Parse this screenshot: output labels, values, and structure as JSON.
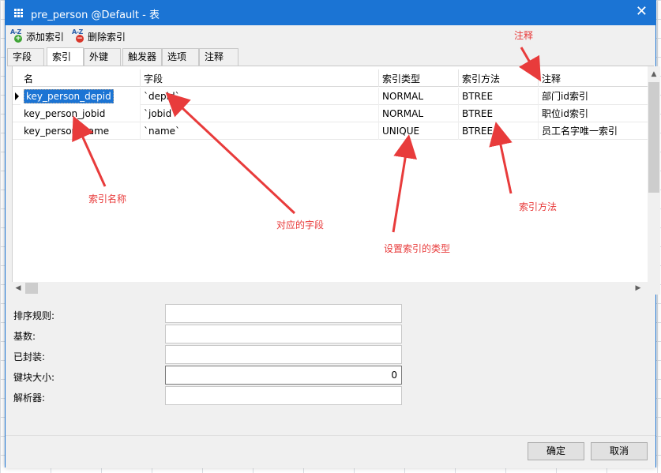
{
  "window": {
    "title": "pre_person @Default - 表",
    "close_label": "✕"
  },
  "toolbar": {
    "add_index": "添加索引",
    "delete_index": "删除索引",
    "add_glyph": "+",
    "delete_glyph": "−",
    "az_glyph": "A-Z"
  },
  "tabs": [
    {
      "label": "字段",
      "active": false
    },
    {
      "label": "索引",
      "active": true
    },
    {
      "label": "外键",
      "active": false
    },
    {
      "label": "触发器",
      "active": false
    },
    {
      "label": "选项",
      "active": false
    },
    {
      "label": "注释",
      "active": false
    }
  ],
  "grid": {
    "headers": [
      "名",
      "字段",
      "索引类型",
      "索引方法",
      "注释"
    ],
    "rows": [
      {
        "name": "key_person_depid",
        "field": "`depid`",
        "type": "NORMAL",
        "method": "BTREE",
        "comment": "部门id索引",
        "selected": true
      },
      {
        "name": "key_person_jobid",
        "field": "`jobid`",
        "type": "NORMAL",
        "method": "BTREE",
        "comment": "职位id索引",
        "selected": false
      },
      {
        "name": "key_person_name",
        "field": "`name`",
        "type": "UNIQUE",
        "method": "BTREE",
        "comment": "员工名字唯一索引",
        "selected": false
      }
    ]
  },
  "properties": [
    {
      "label": "排序规则:",
      "value": ""
    },
    {
      "label": "基数:",
      "value": ""
    },
    {
      "label": "已封装:",
      "value": ""
    },
    {
      "label": "键块大小:",
      "value": "0"
    },
    {
      "label": "解析器:",
      "value": ""
    }
  ],
  "buttons": {
    "ok": "确定",
    "cancel": "取消"
  },
  "annotations": {
    "comment": "注释",
    "index_name": "索引名称",
    "field": "对应的字段",
    "index_type": "设置索引的类型",
    "index_method": "索引方法"
  },
  "colors": {
    "titlebar": "#1b74d4",
    "annotation": "#e83b3b",
    "selection": "#1b74d4"
  }
}
